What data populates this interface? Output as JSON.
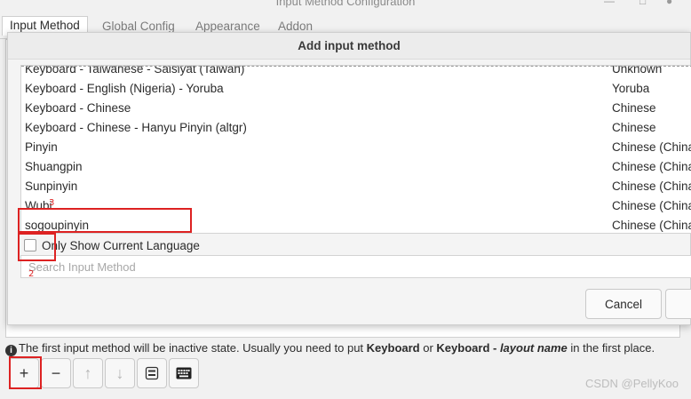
{
  "window": {
    "title": "Input Method Configuration",
    "tabs": [
      "Input Method",
      "Global Config",
      "Appearance",
      "Addon"
    ],
    "active_tab": 0
  },
  "dialog": {
    "title": "Add input method",
    "rows": [
      {
        "name": "Keyboard - Taiwanese - Saisiyat (Taiwan)",
        "lang": "Unknown"
      },
      {
        "name": "Keyboard - English (Nigeria) - Yoruba",
        "lang": "Yoruba"
      },
      {
        "name": "Keyboard - Chinese",
        "lang": "Chinese"
      },
      {
        "name": "Keyboard - Chinese - Hanyu Pinyin (altgr)",
        "lang": "Chinese"
      },
      {
        "name": "Pinyin",
        "lang": "Chinese (China)"
      },
      {
        "name": "Shuangpin",
        "lang": "Chinese (China)"
      },
      {
        "name": "Sunpinyin",
        "lang": "Chinese (China)"
      },
      {
        "name": "Wubi",
        "lang": "Chinese (China)"
      },
      {
        "name": "sogoupinyin",
        "lang": "Chinese (China)"
      }
    ],
    "checkbox_label": "Only Show Current Language",
    "checkbox_checked": false,
    "search_placeholder": "Search Input Method",
    "search_value": "",
    "cancel_label": "Cancel"
  },
  "info": {
    "text_1": "The first input method will be inactive state. Usually you need to put ",
    "bold_1": "Keyboard",
    "text_2": " or ",
    "bold_2": "Keyboard - ",
    "italic": "layout name",
    "text_3": " in the first place."
  },
  "toolbar": {
    "add_label": "+",
    "remove_label": "−",
    "up_label": "↑",
    "down_label": "↓"
  },
  "annotations": {
    "num_2": "2",
    "num_3": "3"
  },
  "watermark": "CSDN @PellyKoo"
}
